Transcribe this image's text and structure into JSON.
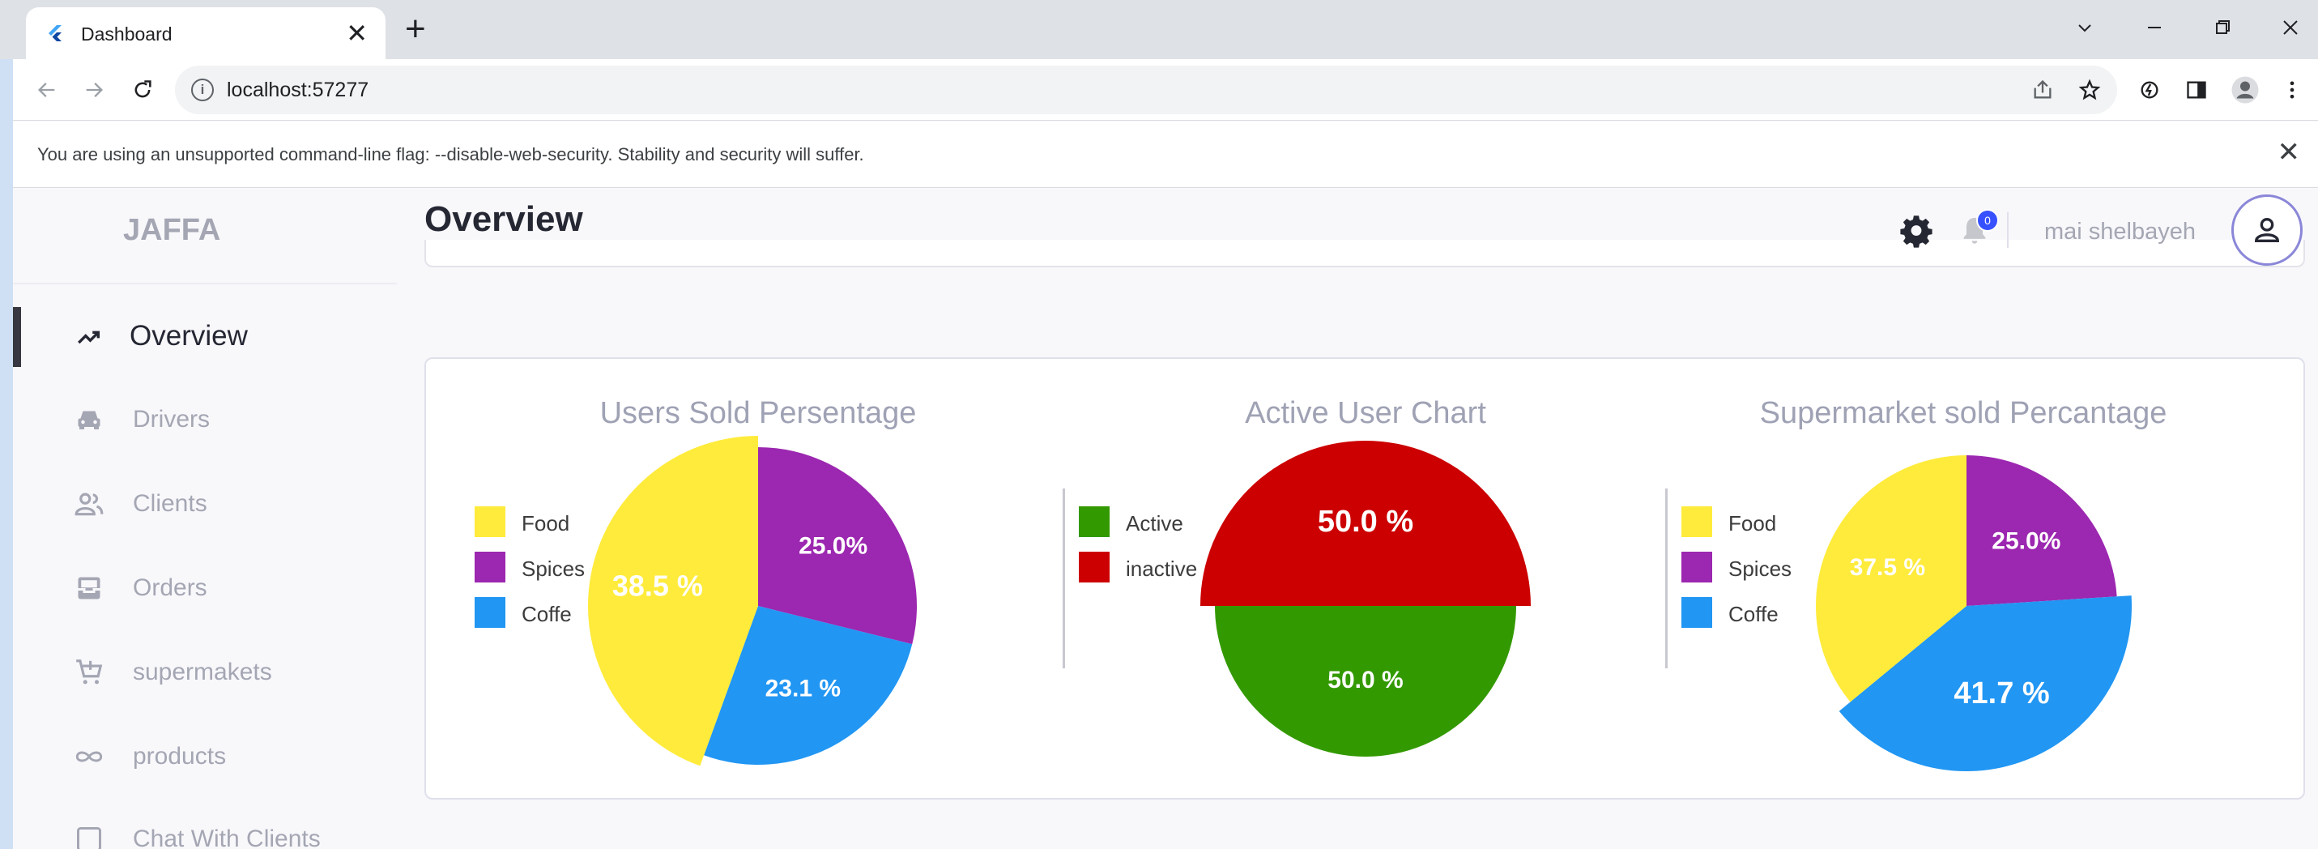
{
  "browser": {
    "tab_title": "Dashboard",
    "tab_close": "✕",
    "new_tab": "+",
    "url": "localhost:57277",
    "infobar_text": "You are using an unsupported command-line flag: --disable-web-security. Stability and security will suffer.",
    "infobar_close": "✕"
  },
  "sidebar": {
    "brand": "JAFFA",
    "items": [
      {
        "label": "Overview",
        "icon": "trending-up-icon",
        "active": true
      },
      {
        "label": "Drivers",
        "icon": "car-icon",
        "active": false
      },
      {
        "label": "Clients",
        "icon": "users-icon",
        "active": false
      },
      {
        "label": "Orders",
        "icon": "inbox-icon",
        "active": false
      },
      {
        "label": "supermakets",
        "icon": "cart-icon",
        "active": false
      },
      {
        "label": "products",
        "icon": "infinity-icon",
        "active": false
      },
      {
        "label": "Chat With Clients",
        "icon": "square-icon",
        "active": false
      }
    ]
  },
  "header": {
    "title": "Overview",
    "notification_count": "0",
    "user_name": "mai shelbayeh"
  },
  "colors": {
    "food": "#ffeb3b",
    "spices": "#9c27b0",
    "coffe": "#2196f3",
    "active": "#339900",
    "inactive": "#cc0000"
  },
  "chart_data": [
    {
      "type": "pie",
      "title": "Users Sold Persentage",
      "legend": [
        "Food",
        "Spices",
        "Coffe"
      ],
      "slices": [
        {
          "name": "Spices",
          "value": 25.0,
          "label": "25.0%"
        },
        {
          "name": "Coffe",
          "value": 23.1,
          "label": "23.1 %"
        },
        {
          "name": "Food",
          "value": 38.5,
          "label": "38.5 %"
        }
      ]
    },
    {
      "type": "pie",
      "title": "Active User Chart",
      "legend": [
        "Active",
        "inactive"
      ],
      "slices": [
        {
          "name": "inactive",
          "value": 50.0,
          "label": "50.0 %"
        },
        {
          "name": "Active",
          "value": 50.0,
          "label": "50.0 %"
        }
      ]
    },
    {
      "type": "pie",
      "title": "Supermarket sold Percantage",
      "legend": [
        "Food",
        "Spices",
        "Coffe"
      ],
      "slices": [
        {
          "name": "Spices",
          "value": 25.0,
          "label": "25.0%"
        },
        {
          "name": "Coffe",
          "value": 41.7,
          "label": "41.7 %"
        },
        {
          "name": "Food",
          "value": 37.5,
          "label": "37.5 %"
        }
      ]
    }
  ]
}
